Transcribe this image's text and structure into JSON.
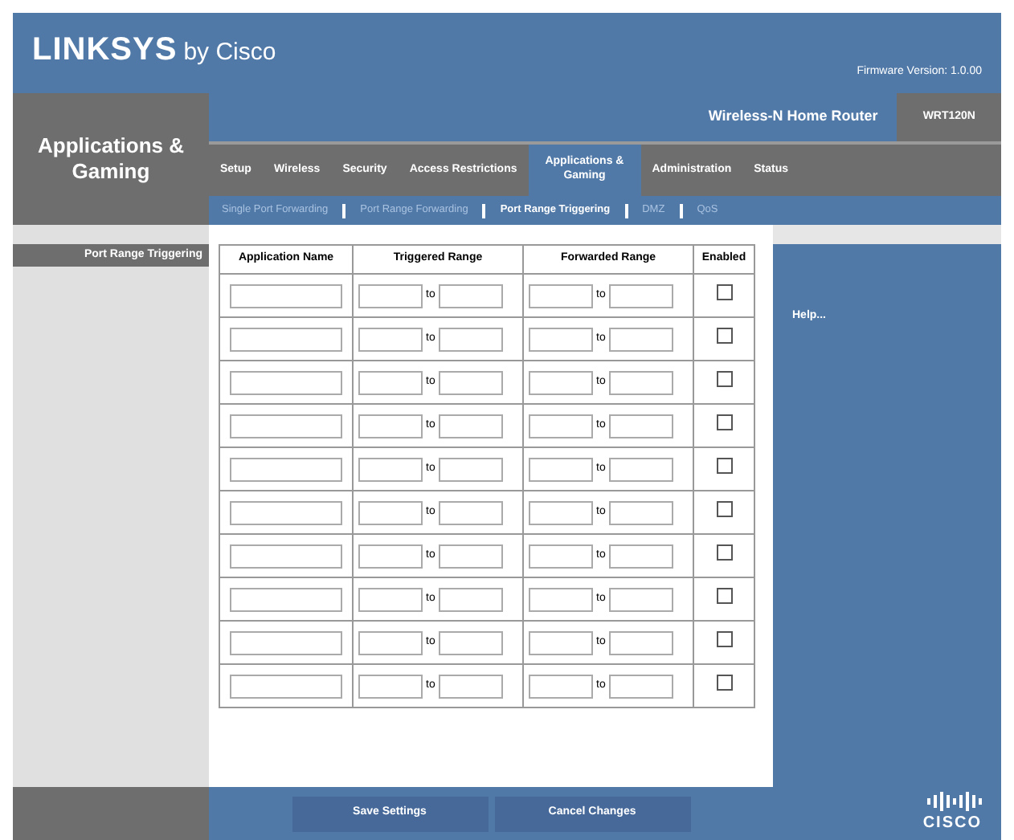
{
  "header": {
    "brand": "LINKSYS",
    "brand_suffix": "by Cisco",
    "firmware": "Firmware Version: 1.0.00"
  },
  "section_title": "Applications & Gaming",
  "product": {
    "name": "Wireless-N Home Router",
    "model": "WRT120N"
  },
  "tabs": [
    {
      "label": "Setup",
      "selected": false
    },
    {
      "label": "Wireless",
      "selected": false
    },
    {
      "label": "Security",
      "selected": false
    },
    {
      "label": "Access Restrictions",
      "selected": false
    },
    {
      "label": "Applications & Gaming",
      "selected": true
    },
    {
      "label": "Administration",
      "selected": false
    },
    {
      "label": "Status",
      "selected": false
    }
  ],
  "subtabs": [
    {
      "label": "Single Port Forwarding",
      "selected": false
    },
    {
      "label": "Port Range Forwarding",
      "selected": false
    },
    {
      "label": "Port Range Triggering",
      "selected": true
    },
    {
      "label": "DMZ",
      "selected": false
    },
    {
      "label": "QoS",
      "selected": false
    }
  ],
  "sidebar_label": "Port Range Triggering",
  "table": {
    "columns": [
      "Application Name",
      "Triggered Range",
      "Forwarded Range",
      "Enabled"
    ],
    "rows": [
      {
        "triggered_to": "to",
        "forwarded_to": "to",
        "enabled": false
      },
      {
        "triggered_to": "to",
        "forwarded_to": "to",
        "enabled": false
      },
      {
        "triggered_to": "to",
        "forwarded_to": "to",
        "enabled": false
      },
      {
        "triggered_to": "to",
        "forwarded_to": "to",
        "enabled": false
      },
      {
        "triggered_to": "to",
        "forwarded_to": "to",
        "enabled": false
      },
      {
        "triggered_to": "to",
        "forwarded_to": "to",
        "enabled": false
      },
      {
        "triggered_to": "to",
        "forwarded_to": "to",
        "enabled": false
      },
      {
        "triggered_to": "to",
        "forwarded_to": "to",
        "enabled": false
      },
      {
        "triggered_to": "to",
        "forwarded_to": "to",
        "enabled": false
      },
      {
        "triggered_to": "to",
        "forwarded_to": "to",
        "enabled": false
      }
    ]
  },
  "help_link": "Help...",
  "buttons": [
    "Save Settings",
    "Cancel Changes"
  ],
  "footer_logo": "CISCO"
}
